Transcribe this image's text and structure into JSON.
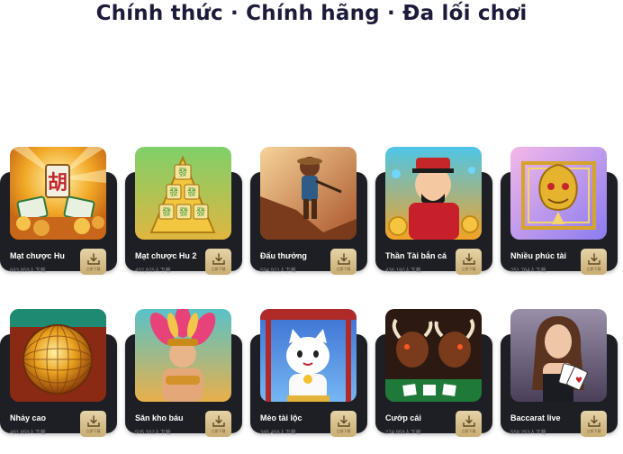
{
  "headline": "Chính thức · Chính hãng · Đa lối chơi",
  "download_label": "立即下载",
  "games": [
    {
      "name": "Mạt chược Hu",
      "count": "683,859人下载",
      "icon": "mahjong-ways-icon"
    },
    {
      "name": "Mạt chược Hu 2",
      "count": "432,825人下载",
      "icon": "mahjong-ways-2-icon"
    },
    {
      "name": "Đấu thưởng",
      "count": "594,921人下载",
      "icon": "treasure-hunter-icon"
    },
    {
      "name": "Thần Tài bắn cá",
      "count": "438,190人下载",
      "icon": "fortune-god-fishing-icon"
    },
    {
      "name": "Nhiều phúc tài",
      "count": "251,764人下载",
      "icon": "golden-dragon-icon"
    },
    {
      "name": "Nhảy cao",
      "count": "481,859人下载",
      "icon": "golden-disco-ball-icon"
    },
    {
      "name": "Săn kho báu",
      "count": "505,332人下载",
      "icon": "treasure-queen-icon"
    },
    {
      "name": "Mèo tài lộc",
      "count": "385,456人下载",
      "icon": "lucky-cat-icon"
    },
    {
      "name": "Cướp cái",
      "count": "274,958人下载",
      "icon": "bull-fight-icon"
    },
    {
      "name": "Baccarat live",
      "count": "558,253人下载",
      "icon": "baccarat-dealer-icon"
    }
  ]
}
